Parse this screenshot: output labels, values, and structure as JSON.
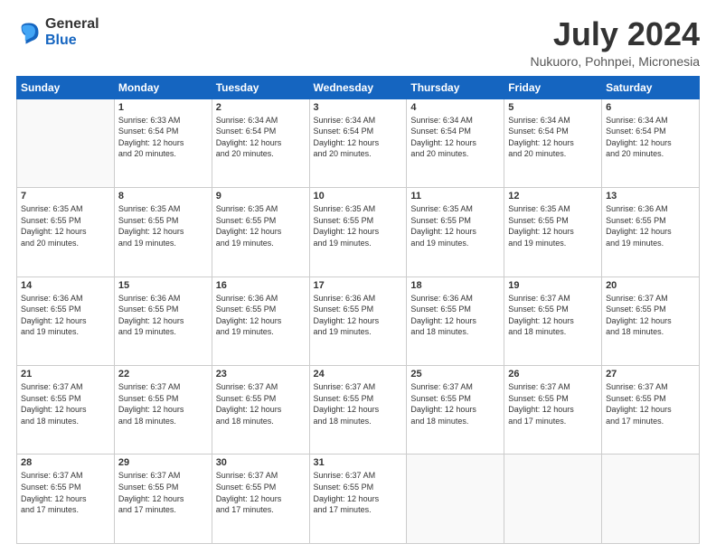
{
  "logo": {
    "general": "General",
    "blue": "Blue"
  },
  "header": {
    "title": "July 2024",
    "subtitle": "Nukuoro, Pohnpei, Micronesia"
  },
  "weekdays": [
    "Sunday",
    "Monday",
    "Tuesday",
    "Wednesday",
    "Thursday",
    "Friday",
    "Saturday"
  ],
  "days": [
    {
      "num": "",
      "info": ""
    },
    {
      "num": "1",
      "info": "Sunrise: 6:33 AM\nSunset: 6:54 PM\nDaylight: 12 hours\nand 20 minutes."
    },
    {
      "num": "2",
      "info": "Sunrise: 6:34 AM\nSunset: 6:54 PM\nDaylight: 12 hours\nand 20 minutes."
    },
    {
      "num": "3",
      "info": "Sunrise: 6:34 AM\nSunset: 6:54 PM\nDaylight: 12 hours\nand 20 minutes."
    },
    {
      "num": "4",
      "info": "Sunrise: 6:34 AM\nSunset: 6:54 PM\nDaylight: 12 hours\nand 20 minutes."
    },
    {
      "num": "5",
      "info": "Sunrise: 6:34 AM\nSunset: 6:54 PM\nDaylight: 12 hours\nand 20 minutes."
    },
    {
      "num": "6",
      "info": "Sunrise: 6:34 AM\nSunset: 6:54 PM\nDaylight: 12 hours\nand 20 minutes."
    },
    {
      "num": "7",
      "info": "Sunrise: 6:35 AM\nSunset: 6:55 PM\nDaylight: 12 hours\nand 20 minutes."
    },
    {
      "num": "8",
      "info": "Sunrise: 6:35 AM\nSunset: 6:55 PM\nDaylight: 12 hours\nand 19 minutes."
    },
    {
      "num": "9",
      "info": "Sunrise: 6:35 AM\nSunset: 6:55 PM\nDaylight: 12 hours\nand 19 minutes."
    },
    {
      "num": "10",
      "info": "Sunrise: 6:35 AM\nSunset: 6:55 PM\nDaylight: 12 hours\nand 19 minutes."
    },
    {
      "num": "11",
      "info": "Sunrise: 6:35 AM\nSunset: 6:55 PM\nDaylight: 12 hours\nand 19 minutes."
    },
    {
      "num": "12",
      "info": "Sunrise: 6:35 AM\nSunset: 6:55 PM\nDaylight: 12 hours\nand 19 minutes."
    },
    {
      "num": "13",
      "info": "Sunrise: 6:36 AM\nSunset: 6:55 PM\nDaylight: 12 hours\nand 19 minutes."
    },
    {
      "num": "14",
      "info": "Sunrise: 6:36 AM\nSunset: 6:55 PM\nDaylight: 12 hours\nand 19 minutes."
    },
    {
      "num": "15",
      "info": "Sunrise: 6:36 AM\nSunset: 6:55 PM\nDaylight: 12 hours\nand 19 minutes."
    },
    {
      "num": "16",
      "info": "Sunrise: 6:36 AM\nSunset: 6:55 PM\nDaylight: 12 hours\nand 19 minutes."
    },
    {
      "num": "17",
      "info": "Sunrise: 6:36 AM\nSunset: 6:55 PM\nDaylight: 12 hours\nand 19 minutes."
    },
    {
      "num": "18",
      "info": "Sunrise: 6:36 AM\nSunset: 6:55 PM\nDaylight: 12 hours\nand 18 minutes."
    },
    {
      "num": "19",
      "info": "Sunrise: 6:37 AM\nSunset: 6:55 PM\nDaylight: 12 hours\nand 18 minutes."
    },
    {
      "num": "20",
      "info": "Sunrise: 6:37 AM\nSunset: 6:55 PM\nDaylight: 12 hours\nand 18 minutes."
    },
    {
      "num": "21",
      "info": "Sunrise: 6:37 AM\nSunset: 6:55 PM\nDaylight: 12 hours\nand 18 minutes."
    },
    {
      "num": "22",
      "info": "Sunrise: 6:37 AM\nSunset: 6:55 PM\nDaylight: 12 hours\nand 18 minutes."
    },
    {
      "num": "23",
      "info": "Sunrise: 6:37 AM\nSunset: 6:55 PM\nDaylight: 12 hours\nand 18 minutes."
    },
    {
      "num": "24",
      "info": "Sunrise: 6:37 AM\nSunset: 6:55 PM\nDaylight: 12 hours\nand 18 minutes."
    },
    {
      "num": "25",
      "info": "Sunrise: 6:37 AM\nSunset: 6:55 PM\nDaylight: 12 hours\nand 18 minutes."
    },
    {
      "num": "26",
      "info": "Sunrise: 6:37 AM\nSunset: 6:55 PM\nDaylight: 12 hours\nand 17 minutes."
    },
    {
      "num": "27",
      "info": "Sunrise: 6:37 AM\nSunset: 6:55 PM\nDaylight: 12 hours\nand 17 minutes."
    },
    {
      "num": "28",
      "info": "Sunrise: 6:37 AM\nSunset: 6:55 PM\nDaylight: 12 hours\nand 17 minutes."
    },
    {
      "num": "29",
      "info": "Sunrise: 6:37 AM\nSunset: 6:55 PM\nDaylight: 12 hours\nand 17 minutes."
    },
    {
      "num": "30",
      "info": "Sunrise: 6:37 AM\nSunset: 6:55 PM\nDaylight: 12 hours\nand 17 minutes."
    },
    {
      "num": "31",
      "info": "Sunrise: 6:37 AM\nSunset: 6:55 PM\nDaylight: 12 hours\nand 17 minutes."
    },
    {
      "num": "",
      "info": ""
    },
    {
      "num": "",
      "info": ""
    },
    {
      "num": "",
      "info": ""
    }
  ]
}
